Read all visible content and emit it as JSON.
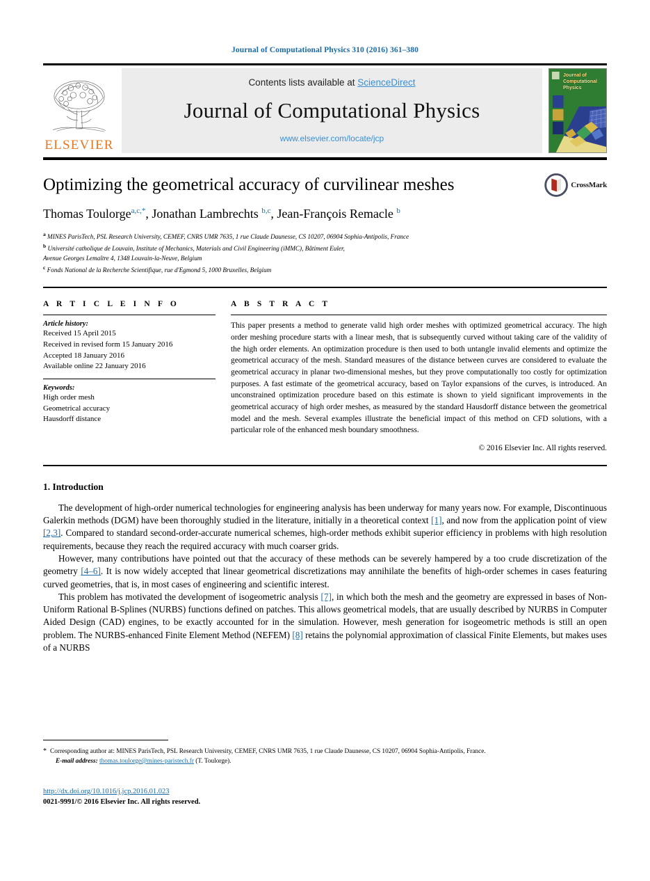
{
  "running_head": "Journal of Computational Physics 310 (2016) 361–380",
  "masthead": {
    "contents_prefix": "Contents lists available at ",
    "sciencedirect": "ScienceDirect",
    "journal_name": "Journal of Computational Physics",
    "journal_url": "www.elsevier.com/locate/jcp",
    "publisher_wordmark": "ELSEVIER",
    "cover_title_lines": [
      "Journal of",
      "Computational",
      "Physics"
    ],
    "cover_bg_color": "#2e7d32",
    "link_color": "#3b8fd4"
  },
  "article": {
    "title": "Optimizing the geometrical accuracy of curvilinear meshes",
    "authors": [
      {
        "name": "Thomas Toulorge",
        "marks": "a,c,*"
      },
      {
        "name": "Jonathan Lambrechts",
        "marks": "b,c"
      },
      {
        "name": "Jean-François Remacle",
        "marks": "b"
      }
    ],
    "affiliations": [
      {
        "mark": "a",
        "text": "MINES ParisTech, PSL Research University, CEMEF, CNRS UMR 7635, 1 rue Claude Daunesse, CS 10207, 06904 Sophia-Antipolis, France"
      },
      {
        "mark": "b",
        "text": "Université catholique de Louvain, Institute of Mechanics, Materials and Civil Engineering (iMMC), Bâtiment Euler,"
      },
      {
        "mark": "",
        "text": "Avenue Georges Lemaître 4, 1348 Louvain-la-Neuve, Belgium"
      },
      {
        "mark": "c",
        "text": "Fonds National de la Recherche Scientifique, rue d'Egmond 5, 1000 Bruxelles, Belgium"
      }
    ],
    "crossmark_label": "CrossMark"
  },
  "info": {
    "heading": "A R T I C L E    I N F O",
    "history_label": "Article history:",
    "history": [
      "Received 15 April 2015",
      "Received in revised form 15 January 2016",
      "Accepted 18 January 2016",
      "Available online 22 January 2016"
    ],
    "keywords_label": "Keywords:",
    "keywords": [
      "High order mesh",
      "Geometrical accuracy",
      "Hausdorff distance"
    ]
  },
  "abstract": {
    "heading": "A B S T R A C T",
    "text": "This paper presents a method to generate valid high order meshes with optimized geometrical accuracy. The high order meshing procedure starts with a linear mesh, that is subsequently curved without taking care of the validity of the high order elements. An optimization procedure is then used to both untangle invalid elements and optimize the geometrical accuracy of the mesh. Standard measures of the distance between curves are considered to evaluate the geometrical accuracy in planar two-dimensional meshes, but they prove computationally too costly for optimization purposes. A fast estimate of the geometrical accuracy, based on Taylor expansions of the curves, is introduced. An unconstrained optimization procedure based on this estimate is shown to yield significant improvements in the geometrical accuracy of high order meshes, as measured by the standard Hausdorff distance between the geometrical model and the mesh. Several examples illustrate the beneficial impact of this method on CFD solutions, with a particular role of the enhanced mesh boundary smoothness.",
    "copyright": "© 2016 Elsevier Inc. All rights reserved."
  },
  "introduction": {
    "section_number_title": "1. Introduction",
    "p1_a": "The development of high-order numerical technologies for engineering analysis has been underway for many years now. For example, Discontinuous Galerkin methods (DGM) have been thoroughly studied in the literature, initially in a theoretical context ",
    "p1_cite1": "[1]",
    "p1_b": ", and now from the application point of view ",
    "p1_cite2": "[2,3]",
    "p1_c": ". Compared to standard second-order-accurate numerical schemes, high-order methods exhibit superior efficiency in problems with high resolution requirements, because they reach the required accuracy with much coarser grids.",
    "p2_a": "However, many contributions have pointed out that the accuracy of these methods can be severely hampered by a too crude discretization of the geometry ",
    "p2_cite": "[4–6]",
    "p2_b": ". It is now widely accepted that linear geometrical discretizations may annihilate the benefits of high-order schemes in cases featuring curved geometries, that is, in most cases of engineering and scientific interest.",
    "p3_a": "This problem has motivated the development of isogeometric analysis ",
    "p3_cite1": "[7]",
    "p3_b": ", in which both the mesh and the geometry are expressed in bases of Non-Uniform Rational B-Splines (NURBS) functions defined on patches. This allows geometrical models, that are usually described by NURBS in Computer Aided Design (CAD) engines, to be exactly accounted for in the simulation. However, mesh generation for isogeometric methods is still an open problem. The NURBS-enhanced Finite Element Method (NEFEM) ",
    "p3_cite2": "[8]",
    "p3_c": " retains the polynomial approximation of classical Finite Elements, but makes uses of a NURBS"
  },
  "footer": {
    "star": "*",
    "corresponding": "Corresponding author at: MINES ParisTech, PSL Research University, CEMEF, CNRS UMR 7635, 1 rue Claude Daunesse, CS 10207, 06904 Sophia-Antipolis, France.",
    "email_label": "E-mail address:",
    "email": "thomas.toulorge@mines-paristech.fr",
    "email_suffix": "(T. Toulorge).",
    "doi": "http://dx.doi.org/10.1016/j.jcp.2016.01.023",
    "issn_line": "0021-9991/© 2016 Elsevier Inc. All rights reserved."
  }
}
